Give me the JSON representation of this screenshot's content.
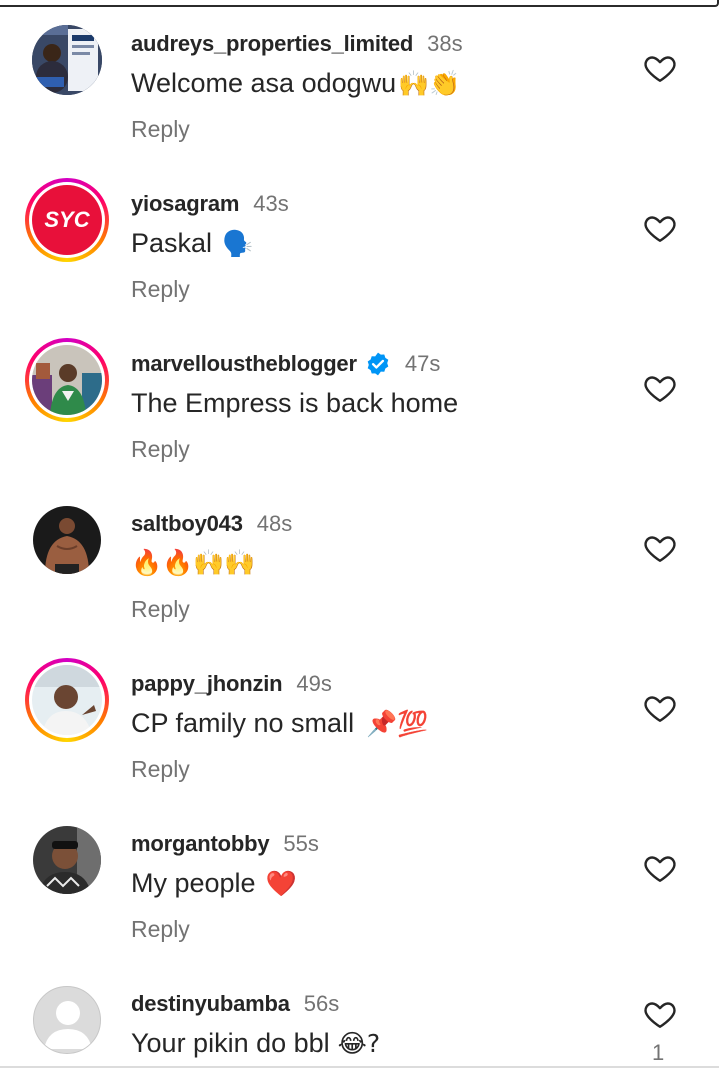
{
  "comments": [
    {
      "username": "audreys_properties_limited",
      "time": "38s",
      "text": "Welcome asa odogwu",
      "emoji": "🙌👏",
      "reply": "Reply",
      "verified": false,
      "avatar": "properties-flyer"
    },
    {
      "username": "yiosagram",
      "time": "43s",
      "text": "Paskal",
      "emoji": "🗣️",
      "reply": "Reply",
      "verified": false,
      "avatar": "syc-logo",
      "avatar_text": "SYC"
    },
    {
      "username": "marvelloustheblogger",
      "time": "47s",
      "text": "The Empress is back home",
      "emoji": "",
      "reply": "Reply",
      "verified": true,
      "avatar": "man-in-store"
    },
    {
      "username": "saltboy043",
      "time": "48s",
      "text": "",
      "emoji": "🔥🔥🙌🙌",
      "reply": "Reply",
      "verified": false,
      "avatar": "shirtless-man"
    },
    {
      "username": "pappy_jhonzin",
      "time": "49s",
      "text": "CP family no small",
      "emoji": "📌💯",
      "reply": "Reply",
      "verified": false,
      "avatar": "man-portrait"
    },
    {
      "username": "morgantobby",
      "time": "55s",
      "text": "My people",
      "emoji": "❤️",
      "reply": "Reply",
      "verified": false,
      "avatar": "man-selfie"
    },
    {
      "username": "destinyubamba",
      "time": "56s",
      "text": "Your pikin do bbl",
      "emoji": "😂?",
      "reply": "",
      "verified": false,
      "avatar": "default-avatar",
      "like_count": "1"
    }
  ],
  "colors": {
    "text": "#262626",
    "muted": "#737373",
    "verified": "#0095f6",
    "syc_red": "#e8103a"
  }
}
